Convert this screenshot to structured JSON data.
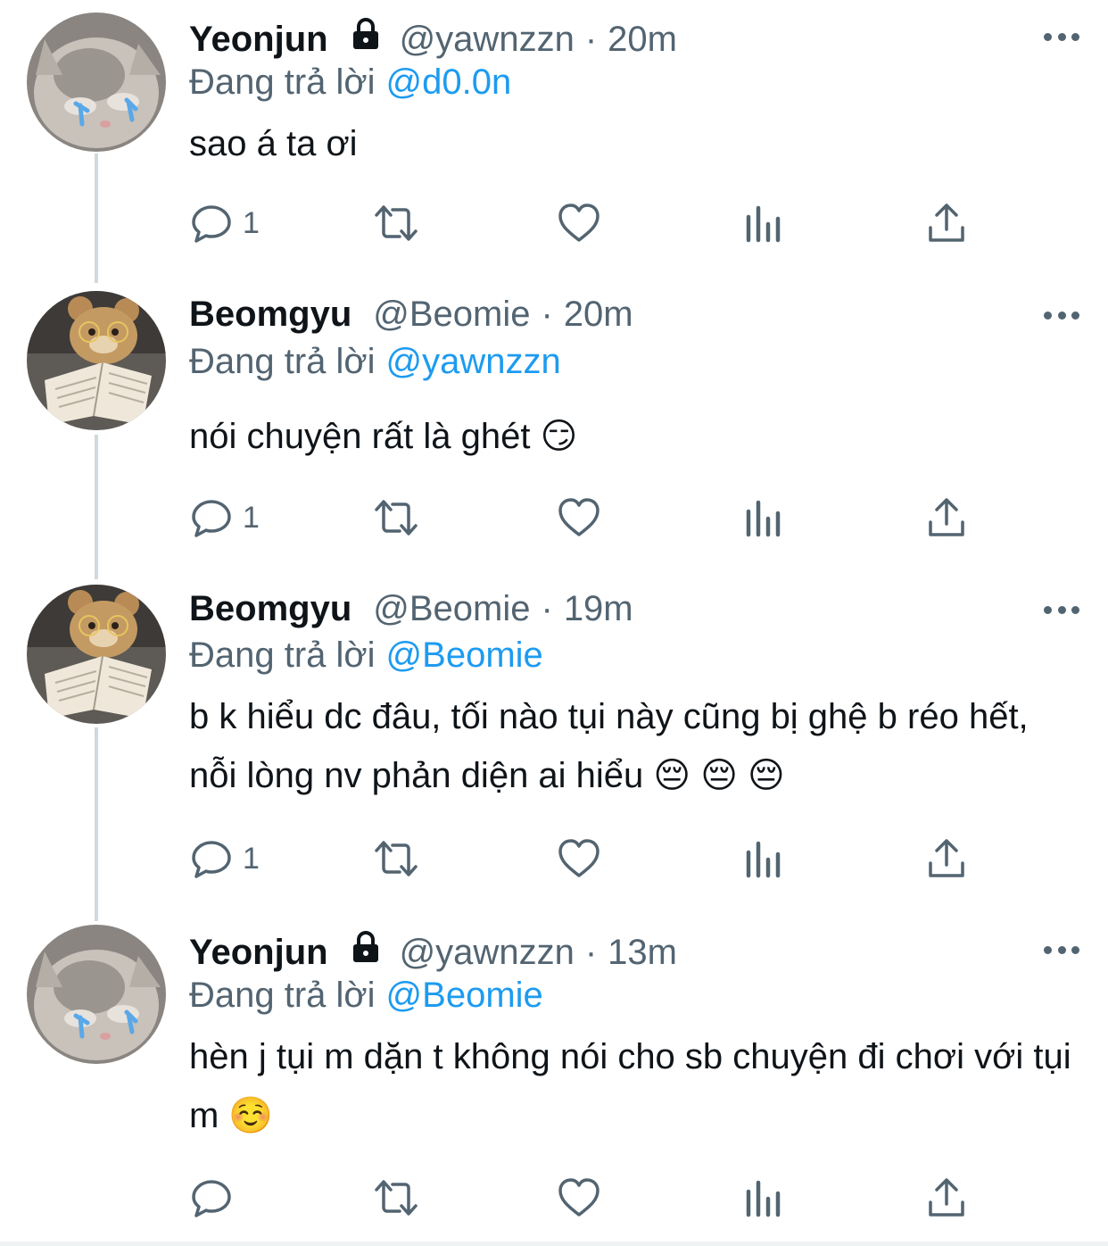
{
  "colors": {
    "accent": "#1d9bf0",
    "secondary_text": "#536471",
    "thread_line": "#cfd9de"
  },
  "tweets": [
    {
      "author": "Yeonjun",
      "locked": true,
      "handle": "@yawnzzn",
      "separator": "·",
      "time": "20m",
      "reply_prefix": "Đang trả lời",
      "reply_to": "@d0.0n",
      "text": "sao á ta ơi",
      "reply_count": "1",
      "avatar": "crying-kitten-avatar"
    },
    {
      "author": "Beomgyu",
      "locked": false,
      "handle": "@Beomie",
      "separator": "·",
      "time": "20m",
      "reply_prefix": "Đang trả lời",
      "reply_to": "@yawnzzn",
      "text": "nói chuyện rất là ghét 😏",
      "reply_count": "1",
      "avatar": "teddy-bear-book-avatar"
    },
    {
      "author": "Beomgyu",
      "locked": false,
      "handle": "@Beomie",
      "separator": "·",
      "time": "19m",
      "reply_prefix": "Đang trả lời",
      "reply_to": "@Beomie",
      "text": "b k hiểu dc đâu, tối nào tụi này cũng bị ghệ b réo hết, nỗi lòng nv phản diện ai hiểu 😔 😔 😔",
      "reply_count": "1",
      "avatar": "teddy-bear-book-avatar"
    },
    {
      "author": "Yeonjun",
      "locked": true,
      "handle": "@yawnzzn",
      "separator": "·",
      "time": "13m",
      "reply_prefix": "Đang trả lời",
      "reply_to": "@Beomie",
      "text": "hèn j tụi m dặn t không nói cho sb chuyện đi chơi với tụi m ☺️",
      "reply_count": "",
      "avatar": "crying-kitten-avatar"
    }
  ]
}
